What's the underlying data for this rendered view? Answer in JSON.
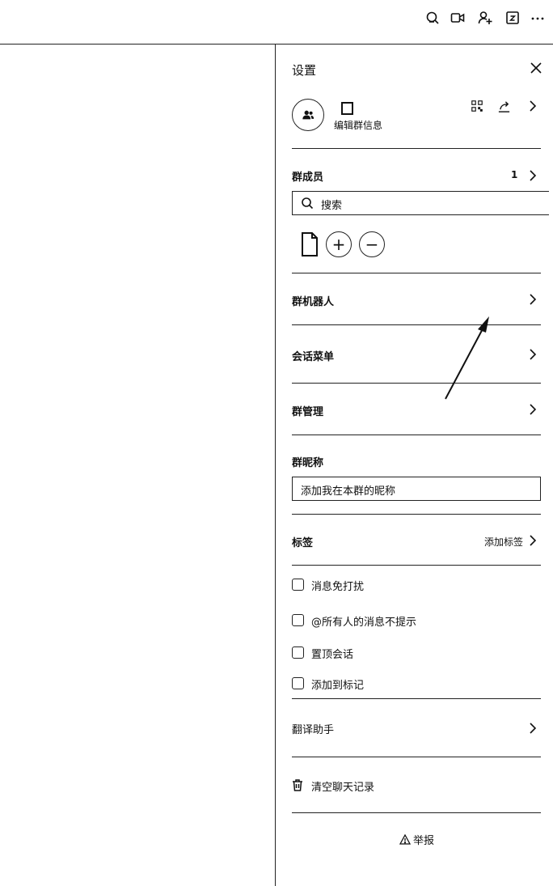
{
  "toolbar": {
    "icons": [
      "chat-search-icon",
      "video-call-icon",
      "add-member-icon",
      "calendar-icon",
      "more-icon"
    ]
  },
  "panel": {
    "title": "设置",
    "group_name_char": "",
    "edit_info_label": "编辑群信息",
    "members": {
      "label": "群成员",
      "count": "1",
      "search_placeholder": "搜索",
      "add_label": "+",
      "remove_label": "−"
    },
    "menu": {
      "robots": "群机器人",
      "session_menu": "会话菜单",
      "management": "群管理"
    },
    "nickname": {
      "label": "群昵称",
      "placeholder": "添加我在本群的昵称"
    },
    "tags": {
      "label": "标签",
      "action": "添加标签"
    },
    "options": [
      {
        "label": "消息免打扰",
        "checked": false
      },
      {
        "label": "@所有人的消息不提示",
        "checked": false
      },
      {
        "label": "置顶会话",
        "checked": false
      },
      {
        "label": "添加到标记",
        "checked": false
      }
    ],
    "translate": "翻译助手",
    "clear_history": "清空聊天记录",
    "report": "举报",
    "report_icon": "warning-icon"
  }
}
